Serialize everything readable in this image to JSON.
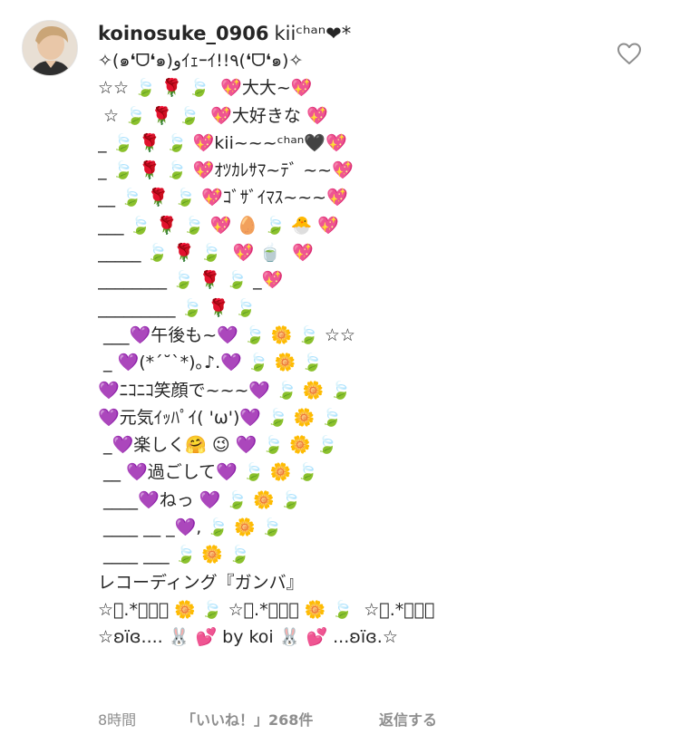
{
  "comment": {
    "username": "koinosuke_0906",
    "header_text": "kiiᶜʰᵃⁿ❤*",
    "lines": [
      "✧(๑❛ᗜ❛๑)ﻭｲｪｰｲ!!٩(❛ᗜ❛๑)✧",
      "☆☆ 🍃 🌹 🍃  💖大大~💖",
      " ☆ 🍃 🌹 🍃  💖大好きな 💖",
      "_ 🍃 🌹 🍃 💖kii~~~ᶜʰᵃⁿ🖤💖",
      "_ 🍃 🌹 🍃 💖ｵﾂｶﾚｻﾏ~ﾃﾞ ~~💖",
      "__ 🍃 🌹 🍃 💖ｺﾞｻﾞｲﾏｽ~~~💖",
      "___ 🍃 🌹 🍃 💖 🥚 🍃 🐣 💖",
      "_____ 🍃 🌹 🍃  💖 🍵  💖",
      "________ 🍃 🌹 🍃 _💖",
      "_________ 🍃 🌹 🍃",
      " ___💜午後も~💜 🍃 🌼 🍃 ☆☆",
      " _ 💜(*´˘`*)｡♪.💜 🍃 🌼 🍃",
      "💜ﾆｺﾆｺ笑顔で~~~💜 🍃 🌼 🍃",
      "💜元気ｲｯﾊﾟｲ( 'ω')💜 🍃 🌼 🍃",
      " _💜楽しく🤗 😉 💜 🍃 🌼 🍃",
      " __ 💜過ごして💜 🍃 🌼 🍃",
      " ____💜ねっ 💜 🍃 🌼 🍃",
      " ____ __ _💜, 🍃 🌼 🍃",
      " ____ ___ 🍃 🌼 🍃",
      "レコーディング『ガンバ』",
      "☆ﾟ.*･｡ﾟ 🌼 🍃 ☆ﾟ.*･｡ﾟ 🌼 🍃  ☆ﾟ.*･｡ﾟ",
      "☆ʚïɞ.... 🐰 💕 by koi 🐰 💕 ...ʚïɞ.☆"
    ]
  },
  "footer": {
    "timestamp": "8時間",
    "likes": "「いいね！」268件",
    "reply": "返信する"
  },
  "icons": {
    "like": "heart-outline-icon",
    "avatar": "avatar"
  },
  "colors": {
    "text": "#262626",
    "meta": "#8e8e8e",
    "heart_outline": "#8e8e8e"
  }
}
